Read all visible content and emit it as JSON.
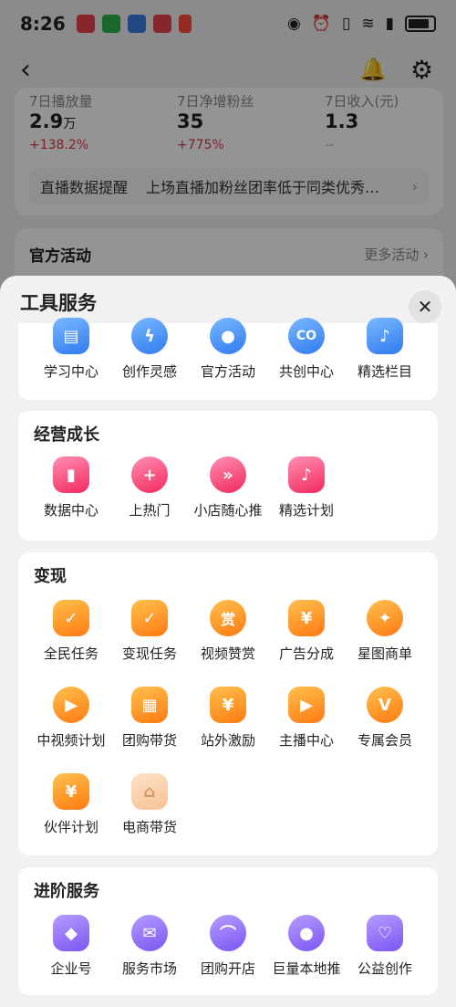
{
  "status_bar": {
    "time": "8:26"
  },
  "stats": [
    {
      "label": "7日播放量",
      "value": "2.9",
      "unit": "万",
      "change": "+138.2%"
    },
    {
      "label": "7日净增粉丝",
      "value": "35",
      "unit": "",
      "change": "+775%"
    },
    {
      "label": "7日收入(元)",
      "value": "1.3",
      "unit": "",
      "change": "--"
    }
  ],
  "tip": {
    "label": "直播数据提醒",
    "text": "上场直播加粉丝团率低于同类优秀…"
  },
  "activity": {
    "title": "官方活动",
    "more": "更多活动"
  },
  "sheet": {
    "title": "工具服务",
    "close": "✕",
    "top_items": [
      {
        "label": "学习中心",
        "icon": "book-icon",
        "glyph": "▤"
      },
      {
        "label": "创作灵感",
        "icon": "lightbulb-icon",
        "glyph": "ϟ"
      },
      {
        "label": "官方活动",
        "icon": "balloon-icon",
        "glyph": "●"
      },
      {
        "label": "共创中心",
        "icon": "co-icon",
        "glyph": "CO"
      },
      {
        "label": "精选栏目",
        "icon": "music-note-icon",
        "glyph": "♪"
      }
    ],
    "growth": {
      "title": "经营成长",
      "items": [
        {
          "label": "数据中心",
          "icon": "bar-chart-icon",
          "glyph": "▮"
        },
        {
          "label": "上热门",
          "icon": "flame-icon",
          "glyph": "+"
        },
        {
          "label": "小店随心推",
          "icon": "boost-icon",
          "glyph": "»"
        },
        {
          "label": "精选计划",
          "icon": "douyin-icon",
          "glyph": "♪"
        }
      ]
    },
    "monetize": {
      "title": "变现",
      "items": [
        {
          "label": "全民任务",
          "icon": "people-icon",
          "glyph": "✓"
        },
        {
          "label": "变现任务",
          "icon": "trophy-icon",
          "glyph": "✓"
        },
        {
          "label": "视频赞赏",
          "icon": "reward-icon",
          "glyph": "赏"
        },
        {
          "label": "广告分成",
          "icon": "money-bag-icon",
          "glyph": "¥"
        },
        {
          "label": "星图商单",
          "icon": "star-map-icon",
          "glyph": "✦"
        },
        {
          "label": "中视频计划",
          "icon": "play-icon",
          "glyph": "▶"
        },
        {
          "label": "团购带货",
          "icon": "store-icon",
          "glyph": "▦"
        },
        {
          "label": "站外激励",
          "icon": "incentive-icon",
          "glyph": "¥"
        },
        {
          "label": "主播中心",
          "icon": "camera-icon",
          "glyph": "▶"
        },
        {
          "label": "专属会员",
          "icon": "vip-icon",
          "glyph": "V"
        },
        {
          "label": "伙伴计划",
          "icon": "partner-icon",
          "glyph": "¥"
        },
        {
          "label": "电商带货",
          "icon": "shopping-bag-icon",
          "glyph": "⌂"
        }
      ]
    },
    "advanced": {
      "title": "进阶服务",
      "items": [
        {
          "label": "企业号",
          "icon": "enterprise-icon",
          "glyph": "◆"
        },
        {
          "label": "服务市场",
          "icon": "service-market-icon",
          "glyph": "✉"
        },
        {
          "label": "团购开店",
          "icon": "open-store-icon",
          "glyph": "⌒"
        },
        {
          "label": "巨量本地推",
          "icon": "location-icon",
          "glyph": "●"
        },
        {
          "label": "公益创作",
          "icon": "charity-icon",
          "glyph": "♡"
        }
      ]
    }
  }
}
